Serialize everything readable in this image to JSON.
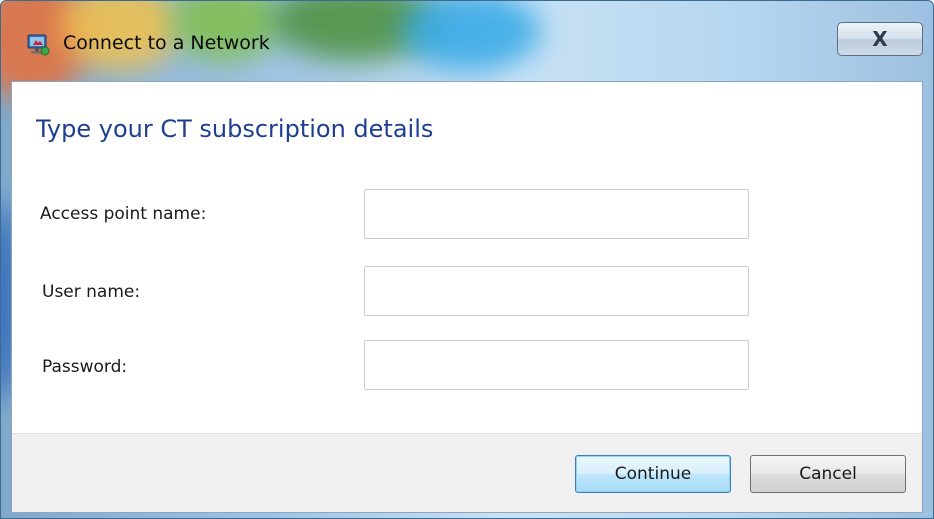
{
  "window": {
    "title": "Connect to a Network",
    "close_label": "X",
    "icon": "network-icon"
  },
  "content": {
    "heading": "Type your CT subscription details",
    "fields": [
      {
        "label": "Access point name:",
        "value": "",
        "placeholder": ""
      },
      {
        "label": "User name:",
        "value": "",
        "placeholder": ""
      },
      {
        "label": "Password:",
        "value": "",
        "placeholder": ""
      }
    ]
  },
  "footer": {
    "continue_label": "Continue",
    "cancel_label": "Cancel"
  },
  "colors": {
    "heading": "#1e3f8f",
    "default_button_border": "#3c7fb1",
    "footer_bg": "#f0f0f0"
  }
}
